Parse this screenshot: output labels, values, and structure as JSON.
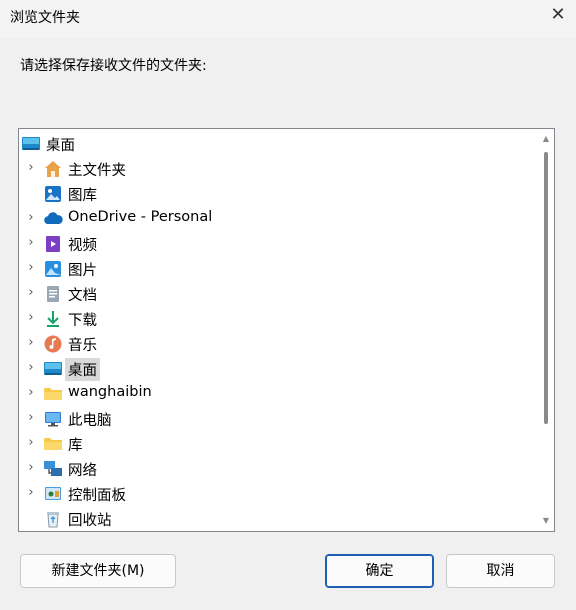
{
  "window": {
    "title": "浏览文件夹",
    "close_glyph": "✕"
  },
  "prompt": "请选择保存接收文件的文件夹:",
  "tree": {
    "root": {
      "label": "桌面",
      "icon": "desktop-icon"
    },
    "items": [
      {
        "label": "主文件夹",
        "icon": "home-icon",
        "expandable": true
      },
      {
        "label": "图库",
        "icon": "gallery-icon",
        "expandable": false
      },
      {
        "label": "OneDrive - Personal",
        "icon": "onedrive-cloud-icon",
        "expandable": true
      },
      {
        "label": "视频",
        "icon": "videos-icon",
        "expandable": true
      },
      {
        "label": "图片",
        "icon": "pictures-icon",
        "expandable": true
      },
      {
        "label": "文档",
        "icon": "documents-icon",
        "expandable": true
      },
      {
        "label": "下载",
        "icon": "downloads-icon",
        "expandable": true
      },
      {
        "label": "音乐",
        "icon": "music-icon",
        "expandable": true
      },
      {
        "label": "桌面",
        "icon": "desktop-icon",
        "expandable": true,
        "selected": true
      },
      {
        "label": "wanghaibin",
        "icon": "folder-icon",
        "expandable": true
      },
      {
        "label": "此电脑",
        "icon": "computer-icon",
        "expandable": true
      },
      {
        "label": "库",
        "icon": "folder-icon",
        "expandable": true
      },
      {
        "label": "网络",
        "icon": "network-icon",
        "expandable": true
      },
      {
        "label": "控制面板",
        "icon": "control-panel-icon",
        "expandable": true
      },
      {
        "label": "回收站",
        "icon": "recycle-bin-icon",
        "expandable": false
      }
    ]
  },
  "buttons": {
    "new_folder": "新建文件夹(M)",
    "ok": "确定",
    "cancel": "取消"
  }
}
